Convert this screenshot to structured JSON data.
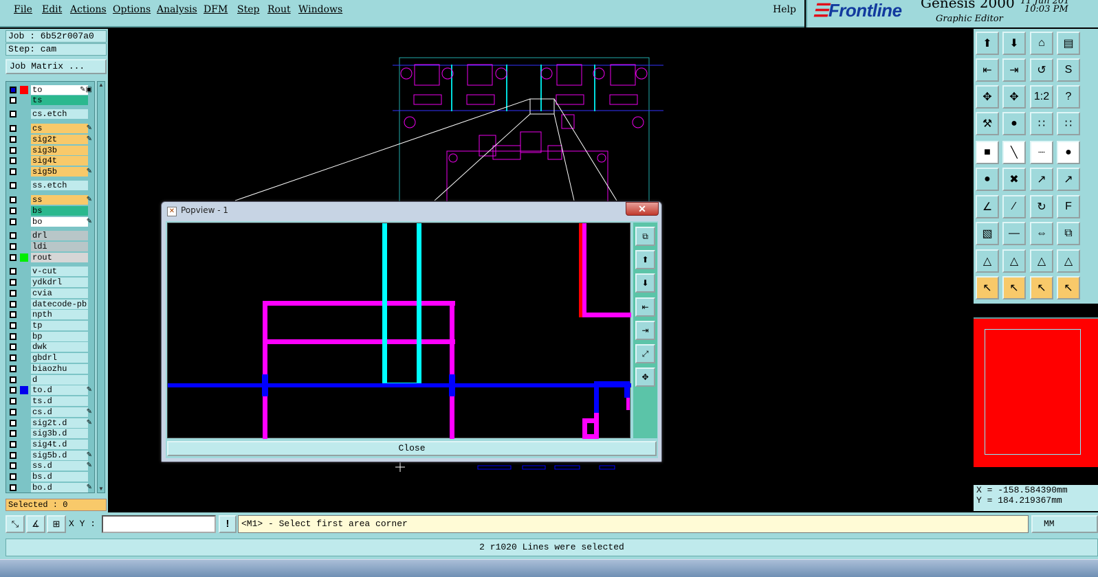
{
  "menu": {
    "items": [
      "File",
      "Edit",
      "Actions",
      "Options",
      "Analysis",
      "DFM",
      "Step",
      "Rout",
      "Windows"
    ],
    "help": "Help"
  },
  "brand": {
    "logo": "Frontline",
    "product": "Genesis 2000",
    "subtitle": "Graphic Editor",
    "date": "11 Jun 201",
    "time": "10:03 PM"
  },
  "job": {
    "job_label": "Job : 6b52r007a0",
    "step_label": "Step: cam",
    "matrix_button": "Job Matrix ..."
  },
  "layers": [
    {
      "name": "to",
      "bg": "#ffffff",
      "color": "#ff0000",
      "marker": "#0000cc",
      "edit": "✎▣"
    },
    {
      "name": "ts",
      "bg": "#2bb88e",
      "color": "",
      "marker": "",
      "edit": ""
    },
    {
      "name": "cs.etch",
      "bg": "#bfeaec",
      "color": "",
      "marker": "",
      "edit": ""
    },
    {
      "name": "cs",
      "bg": "#f8c96a",
      "color": "",
      "marker": "",
      "edit": "✎"
    },
    {
      "name": "sig2t",
      "bg": "#f8c96a",
      "color": "",
      "marker": "",
      "edit": "✎"
    },
    {
      "name": "sig3b",
      "bg": "#f8c96a",
      "color": "",
      "marker": "",
      "edit": ""
    },
    {
      "name": "sig4t",
      "bg": "#f8c96a",
      "color": "",
      "marker": "",
      "edit": ""
    },
    {
      "name": "sig5b",
      "bg": "#f8c96a",
      "color": "",
      "marker": "",
      "edit": "✎"
    },
    {
      "name": "ss.etch",
      "bg": "#bfeaec",
      "color": "",
      "marker": "",
      "edit": ""
    },
    {
      "name": "ss",
      "bg": "#f8c96a",
      "color": "",
      "marker": "",
      "edit": "✎"
    },
    {
      "name": "bs",
      "bg": "#2bb88e",
      "color": "",
      "marker": "",
      "edit": ""
    },
    {
      "name": "bo",
      "bg": "#ffffff",
      "color": "",
      "marker": "",
      "edit": "✎"
    },
    {
      "name": "drl",
      "bg": "#b8c6c8",
      "color": "",
      "marker": "",
      "edit": ""
    },
    {
      "name": "ldi",
      "bg": "#b8c6c8",
      "color": "",
      "marker": "",
      "edit": ""
    },
    {
      "name": "rout",
      "bg": "#d6d6d6",
      "color": "#00ee00",
      "marker": "",
      "edit": ""
    },
    {
      "name": "v-cut",
      "bg": "#bfeaec",
      "color": "",
      "marker": "",
      "edit": ""
    },
    {
      "name": "ydkdrl",
      "bg": "#bfeaec",
      "color": "",
      "marker": "",
      "edit": ""
    },
    {
      "name": "cvia",
      "bg": "#bfeaec",
      "color": "",
      "marker": "",
      "edit": ""
    },
    {
      "name": "datecode-pb",
      "bg": "#bfeaec",
      "color": "",
      "marker": "",
      "edit": ""
    },
    {
      "name": "npth",
      "bg": "#bfeaec",
      "color": "",
      "marker": "",
      "edit": ""
    },
    {
      "name": "tp",
      "bg": "#bfeaec",
      "color": "",
      "marker": "",
      "edit": ""
    },
    {
      "name": "bp",
      "bg": "#bfeaec",
      "color": "",
      "marker": "",
      "edit": ""
    },
    {
      "name": "dwk",
      "bg": "#bfeaec",
      "color": "",
      "marker": "",
      "edit": ""
    },
    {
      "name": "gbdrl",
      "bg": "#bfeaec",
      "color": "",
      "marker": "",
      "edit": ""
    },
    {
      "name": "biaozhu",
      "bg": "#bfeaec",
      "color": "",
      "marker": "",
      "edit": ""
    },
    {
      "name": "d",
      "bg": "#bfeaec",
      "color": "",
      "marker": "",
      "edit": ""
    },
    {
      "name": "to.d",
      "bg": "#bfeaec",
      "color": "#0000ee",
      "marker": "",
      "edit": "✎"
    },
    {
      "name": "ts.d",
      "bg": "#bfeaec",
      "color": "",
      "marker": "",
      "edit": ""
    },
    {
      "name": "cs.d",
      "bg": "#bfeaec",
      "color": "",
      "marker": "",
      "edit": "✎"
    },
    {
      "name": "sig2t.d",
      "bg": "#bfeaec",
      "color": "",
      "marker": "",
      "edit": "✎"
    },
    {
      "name": "sig3b.d",
      "bg": "#bfeaec",
      "color": "",
      "marker": "",
      "edit": ""
    },
    {
      "name": "sig4t.d",
      "bg": "#bfeaec",
      "color": "",
      "marker": "",
      "edit": ""
    },
    {
      "name": "sig5b.d",
      "bg": "#bfeaec",
      "color": "",
      "marker": "",
      "edit": "✎"
    },
    {
      "name": "ss.d",
      "bg": "#bfeaec",
      "color": "",
      "marker": "",
      "edit": "✎"
    },
    {
      "name": "bs.d",
      "bg": "#bfeaec",
      "color": "",
      "marker": "",
      "edit": ""
    },
    {
      "name": "bo.d",
      "bg": "#bfeaec",
      "color": "",
      "marker": "",
      "edit": "✎"
    }
  ],
  "selected": "Selected : 0",
  "popview": {
    "title": "Popview - 1",
    "close_x": "✕",
    "close_button": "Close",
    "tool_icons": [
      "⧉",
      "⬆",
      "⬇",
      "⇤",
      "⇥",
      "⤢",
      "✥"
    ]
  },
  "right_tools": {
    "row_icons": [
      "⬆",
      "⬇",
      "⌂",
      "▤",
      "⇤",
      "⇥",
      "↺",
      "S",
      "✥",
      "✥",
      "1:2",
      "?",
      "⚒",
      "●",
      "∷",
      "∷",
      "■",
      "╲",
      "┈",
      "●",
      "●",
      "✖",
      "↗",
      "↗",
      "∠",
      "∕",
      "↻",
      "F",
      "▧",
      "—",
      "⇔",
      "⧉",
      "△",
      "△",
      "△",
      "△",
      "↖",
      "↖",
      "↖",
      "↖"
    ]
  },
  "coords": {
    "x": "X = -158.584390mm",
    "y": "Y =  184.219367mm"
  },
  "command": {
    "xy_label": "X Y :",
    "xy_value": "",
    "prompt": "<M1> - Select first area corner",
    "units": "MM"
  },
  "status": "2 r1020 Lines were selected",
  "colors": {
    "panel": "#9fd9db",
    "trace_magenta": "#ff00ff",
    "trace_cyan": "#00ffff",
    "trace_blue": "#0000ff",
    "trace_red": "#ff0000"
  }
}
